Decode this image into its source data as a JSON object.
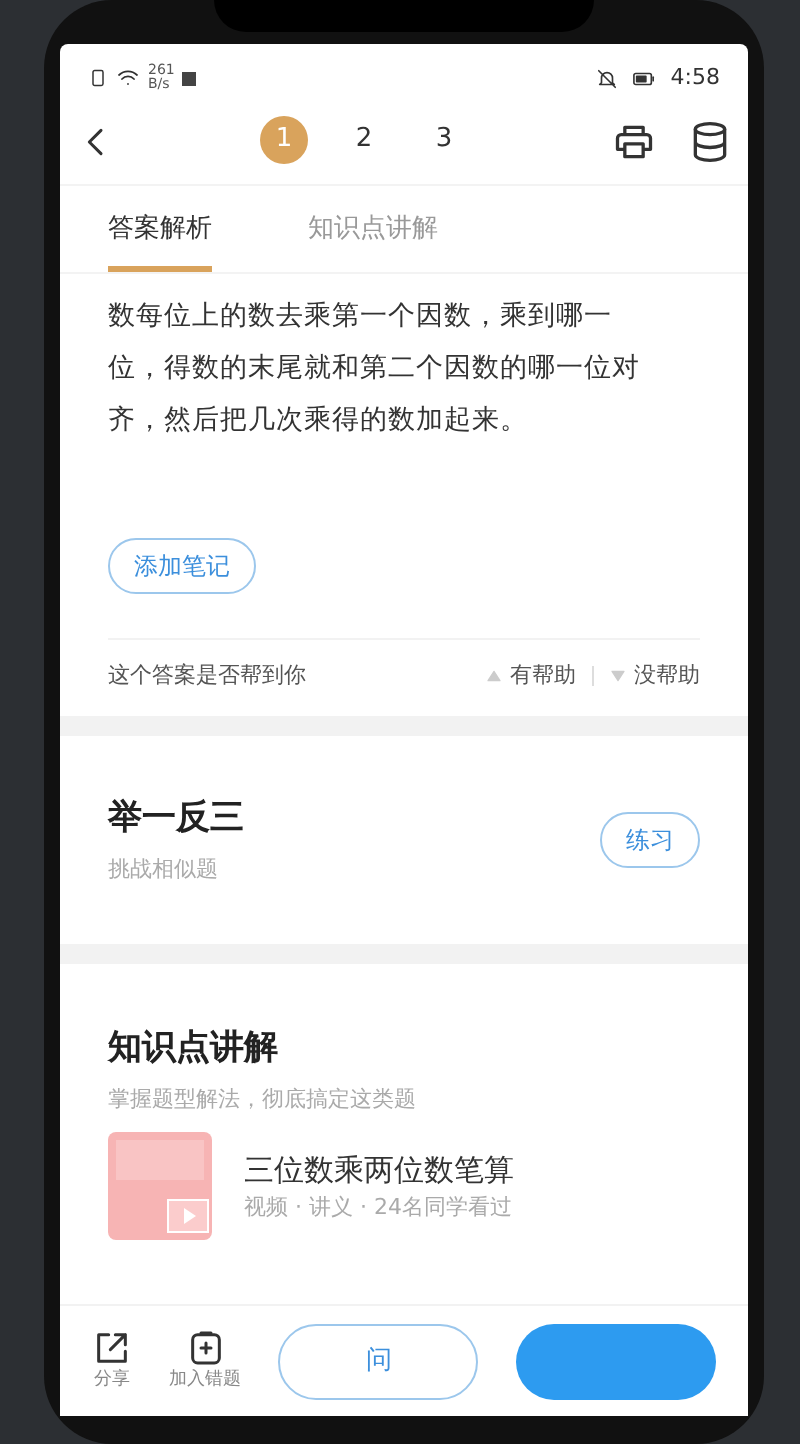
{
  "status_bar": {
    "speed_value": "261",
    "speed_unit": "B/s",
    "time": "4:58"
  },
  "pager": [
    {
      "label": "1",
      "selected": true
    },
    {
      "label": "2",
      "selected": false
    },
    {
      "label": "3",
      "selected": false
    }
  ],
  "tabs": [
    {
      "label": "答案解析",
      "selected": true
    },
    {
      "label": "知识点讲解",
      "selected": false
    }
  ],
  "answer_text": "数每位上的数去乘第一个因数，乘到哪一位，得数的末尾就和第二个因数的哪一位对齐，然后把几次乘得的数加起来。",
  "add_note": "添加笔记",
  "feedback": {
    "question": "这个答案是否帮到你",
    "helpful": "有帮助",
    "not_helpful": "没帮助"
  },
  "practice": {
    "title": "举一反三",
    "subtitle": "挑战相似题",
    "button": "练习"
  },
  "knowledge": {
    "title": "知识点讲解",
    "subtitle": "掌握题型解法，彻底搞定这类题",
    "item": {
      "title": "三位数乘两位数笔算",
      "meta": "视频 · 讲义 · 24名同学看过"
    }
  },
  "bottom_bar": {
    "share": "分享",
    "add_wrong": "加入错题",
    "ask_button": "问"
  }
}
